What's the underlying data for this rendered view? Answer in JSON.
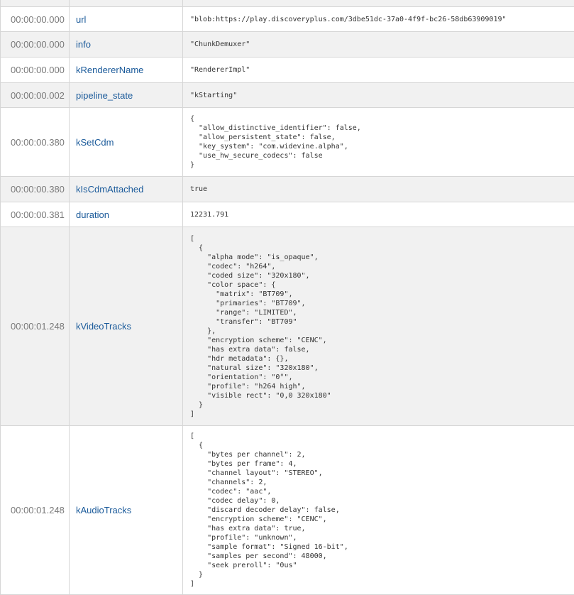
{
  "rows": [
    {
      "time": "",
      "property": "",
      "value": ""
    },
    {
      "time": "00:00:00.000",
      "property": "url",
      "value": "\"blob:https://play.discoveryplus.com/3dbe51dc-37a0-4f9f-bc26-58db63909019\""
    },
    {
      "time": "00:00:00.000",
      "property": "info",
      "value": "\"ChunkDemuxer\""
    },
    {
      "time": "00:00:00.000",
      "property": "kRendererName",
      "value": "\"RendererImpl\""
    },
    {
      "time": "00:00:00.002",
      "property": "pipeline_state",
      "value": "\"kStarting\""
    },
    {
      "time": "00:00:00.380",
      "property": "kSetCdm",
      "value": "{\n  \"allow_distinctive_identifier\": false,\n  \"allow_persistent_state\": false,\n  \"key_system\": \"com.widevine.alpha\",\n  \"use_hw_secure_codecs\": false\n}"
    },
    {
      "time": "00:00:00.380",
      "property": "kIsCdmAttached",
      "value": "true"
    },
    {
      "time": "00:00:00.381",
      "property": "duration",
      "value": "12231.791"
    },
    {
      "time": "00:00:01.248",
      "property": "kVideoTracks",
      "value": "[\n  {\n    \"alpha mode\": \"is_opaque\",\n    \"codec\": \"h264\",\n    \"coded size\": \"320x180\",\n    \"color space\": {\n      \"matrix\": \"BT709\",\n      \"primaries\": \"BT709\",\n      \"range\": \"LIMITED\",\n      \"transfer\": \"BT709\"\n    },\n    \"encryption scheme\": \"CENC\",\n    \"has extra data\": false,\n    \"hdr metadata\": {},\n    \"natural size\": \"320x180\",\n    \"orientation\": \"0°\",\n    \"profile\": \"h264 high\",\n    \"visible rect\": \"0,0 320x180\"\n  }\n]"
    },
    {
      "time": "00:00:01.248",
      "property": "kAudioTracks",
      "value": "[\n  {\n    \"bytes per channel\": 2,\n    \"bytes per frame\": 4,\n    \"channel layout\": \"STEREO\",\n    \"channels\": 2,\n    \"codec\": \"aac\",\n    \"codec delay\": 0,\n    \"discard decoder delay\": false,\n    \"encryption scheme\": \"CENC\",\n    \"has extra data\": true,\n    \"profile\": \"unknown\",\n    \"sample format\": \"Signed 16-bit\",\n    \"samples per second\": 48000,\n    \"seek preroll\": \"0us\"\n  }\n]"
    }
  ]
}
